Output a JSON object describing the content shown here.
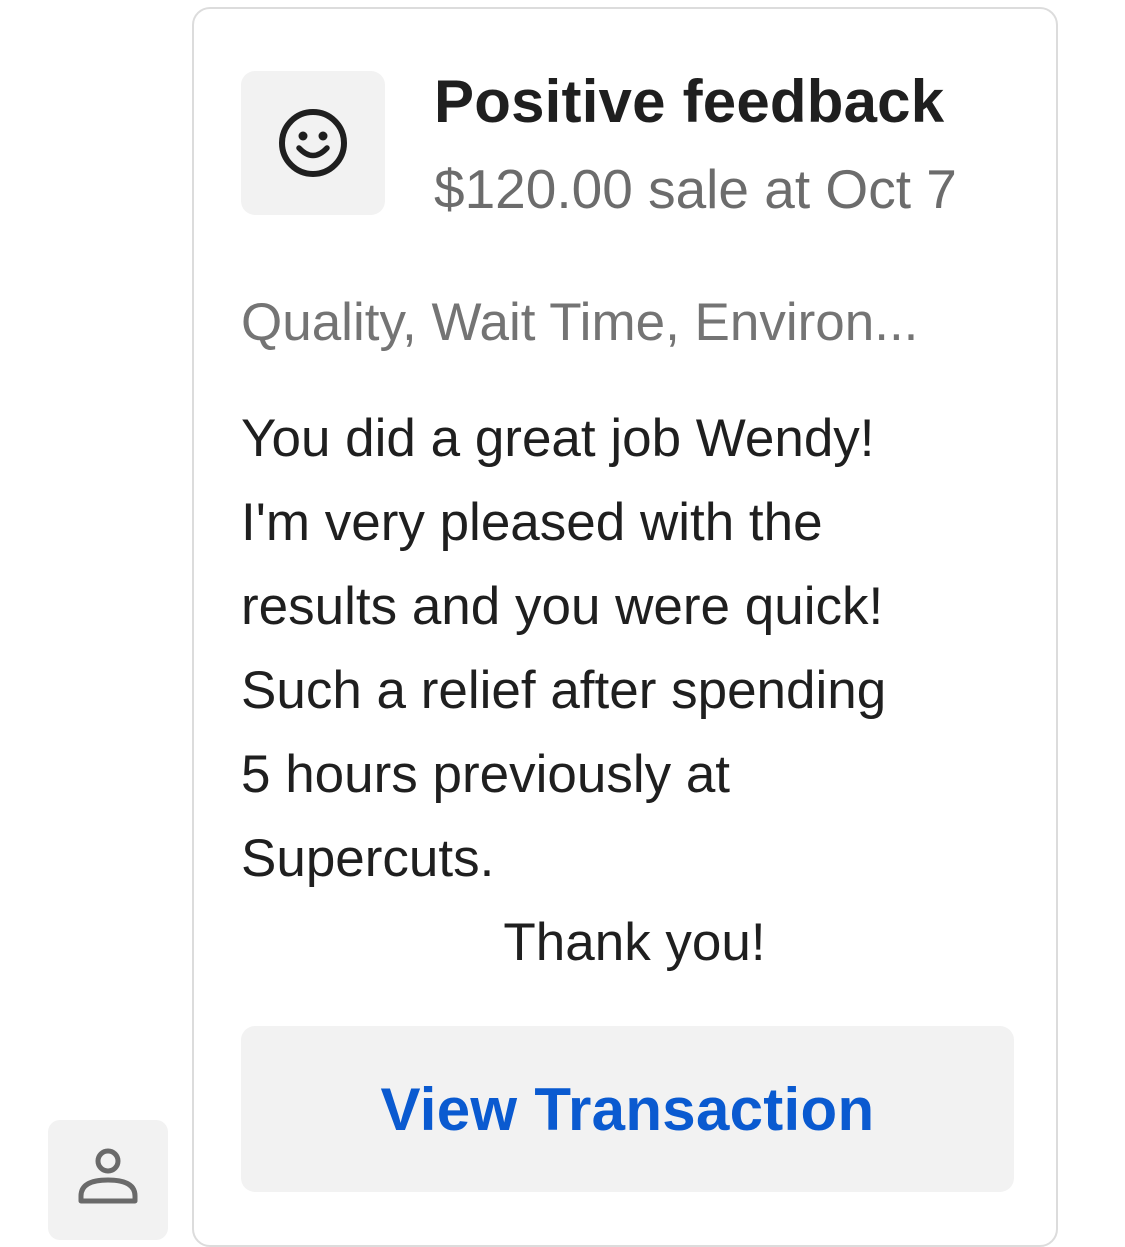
{
  "card": {
    "icon": "smiley-face-icon",
    "title": "Positive feedback",
    "subtitle": "$120.00 sale at Oct 7",
    "tags": "Quality, Wait Time, Environ...",
    "comment_lines": [
      "You did a great job Wendy!",
      "I'm very pleased with the",
      "results and you were quick!",
      "Such a relief after spending",
      "5 hours previously at",
      "Supercuts.",
      "Thank you!"
    ],
    "button_label": "View Transaction"
  },
  "avatar": {
    "icon": "person-icon"
  },
  "colors": {
    "accent": "#0a5ad0",
    "tile_background": "#f2f2f2",
    "muted_text": "#6c6c6c",
    "card_border": "#dcdcdc"
  }
}
